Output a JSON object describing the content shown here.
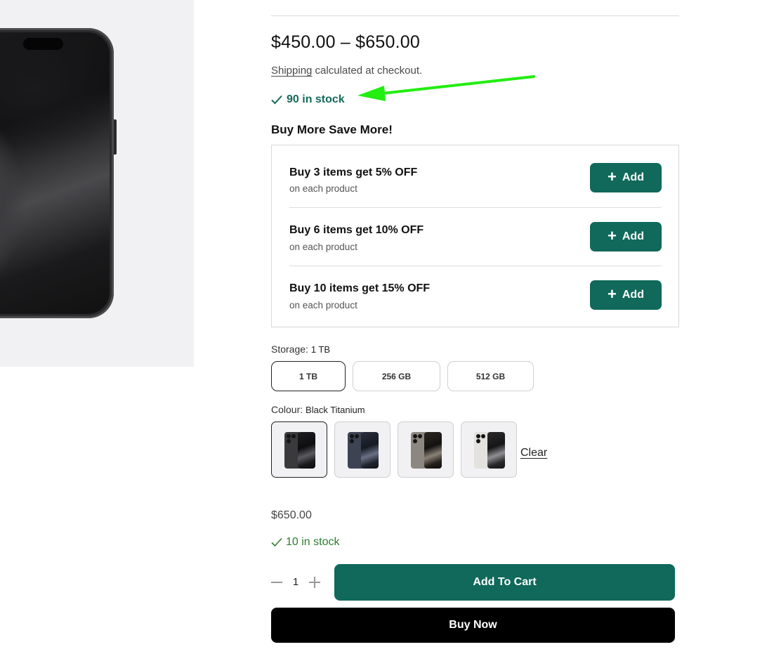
{
  "product": {
    "image_alt": "Black Titanium smartphone",
    "price_range": "$450.00 – $650.00",
    "shipping_link": "Shipping",
    "shipping_text": " calculated at checkout.",
    "stock": "90 in stock"
  },
  "annotation": {
    "arrow_color": "#22ee11"
  },
  "bundle": {
    "title": "Buy More Save More!",
    "offers": [
      {
        "title": "Buy 3 items get 5% OFF",
        "subtitle": "on each product",
        "button_label": "Add"
      },
      {
        "title": "Buy 6 items get 10% OFF",
        "subtitle": "on each product",
        "button_label": "Add"
      },
      {
        "title": "Buy 10 items get 15% OFF",
        "subtitle": "on each product",
        "button_label": "Add"
      }
    ]
  },
  "storage": {
    "label": "Storage:",
    "selected": "1 TB",
    "options": [
      "1 TB",
      "256 GB",
      "512 GB"
    ]
  },
  "colour": {
    "label": "Colour:",
    "selected": "Black Titanium",
    "options": [
      {
        "name": "Black Titanium",
        "swatch": "#3a3a3c"
      },
      {
        "name": "Blue Titanium",
        "swatch": "#3d4353"
      },
      {
        "name": "Natural Titanium",
        "swatch": "#8c8780"
      },
      {
        "name": "White Titanium",
        "swatch": "#e4e2de"
      }
    ],
    "clear_label": "Clear"
  },
  "variant": {
    "price": "$650.00",
    "stock": "10 in stock"
  },
  "purchase": {
    "quantity": "1",
    "add_to_cart_label": "Add To Cart",
    "buy_now_label": "Buy Now"
  },
  "colors": {
    "accent": "#10695a",
    "stock_text": "#136b5a",
    "variant_stock_text": "#2e7d32",
    "buy_now_bg": "#000000"
  }
}
